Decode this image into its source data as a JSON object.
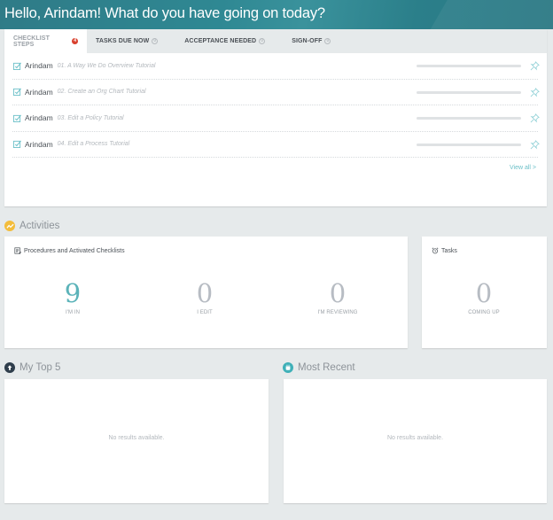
{
  "header": {
    "greeting": "Hello, Arindam! What do you have going on today?"
  },
  "tabs": [
    {
      "label": "CHECKLIST STEPS",
      "count": "4",
      "active": true
    },
    {
      "label": "TASKS DUE NOW",
      "count": "0",
      "active": false
    },
    {
      "label": "ACCEPTANCE NEEDED",
      "count": "0",
      "active": false
    },
    {
      "label": "SIGN-OFF",
      "count": "0",
      "active": false
    }
  ],
  "checklist_steps": {
    "items": [
      {
        "owner": "Arindam",
        "step": "01. A Way We Do Overview Tutorial",
        "progress": 0
      },
      {
        "owner": "Arindam",
        "step": "02. Create an Org Chart Tutorial",
        "progress": 0
      },
      {
        "owner": "Arindam",
        "step": "03. Edit a Policy Tutorial",
        "progress": 0
      },
      {
        "owner": "Arindam",
        "step": "04. Edit a Process Tutorial",
        "progress": 0
      }
    ],
    "view_all_label": "View all >"
  },
  "activities": {
    "title": "Activities",
    "procedures_card": {
      "title": "Procedures and Activated Checklists",
      "stats": [
        {
          "value": "9",
          "label": "I'M IN"
        },
        {
          "value": "0",
          "label": "I EDIT"
        },
        {
          "value": "0",
          "label": "I'M REVIEWING"
        }
      ]
    },
    "tasks_card": {
      "title": "Tasks",
      "stats": [
        {
          "value": "0",
          "label": "COMING UP"
        }
      ]
    }
  },
  "my_top5": {
    "title": "My Top 5",
    "empty_message": "No results available."
  },
  "most_recent": {
    "title": "Most Recent",
    "empty_message": "No results available."
  },
  "colors": {
    "accent_teal": "#5bb3b9",
    "badge_red": "#d9412e",
    "activities_icon": "#f3bd3c",
    "top5_icon": "#2f3e4c",
    "recent_icon": "#3fb0b8"
  }
}
